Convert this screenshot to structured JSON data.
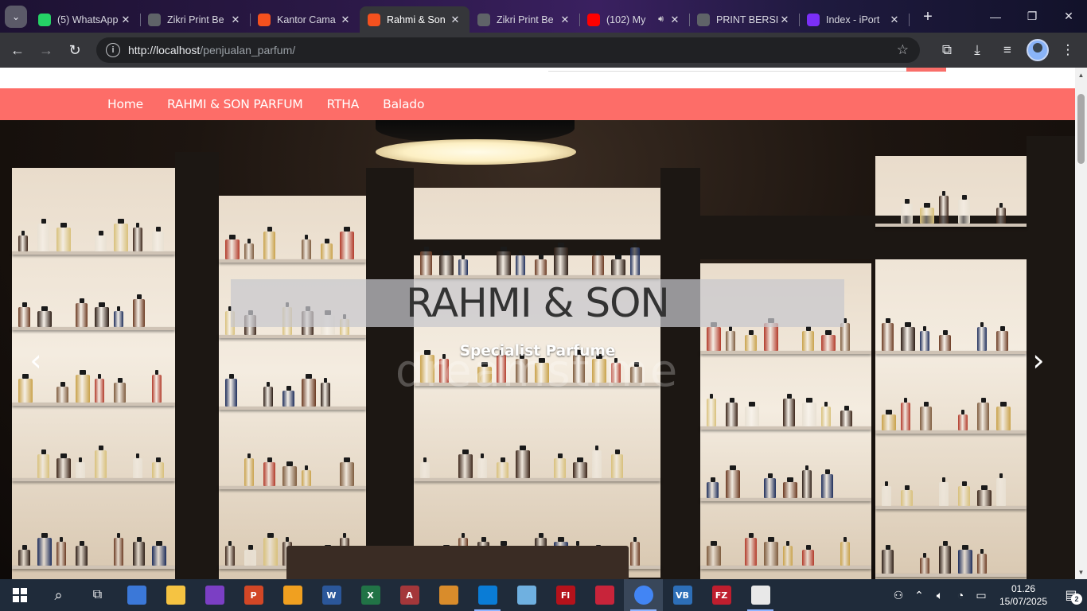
{
  "browser": {
    "tabs": [
      {
        "title": "(5) WhatsApp",
        "favicon_color": "#25d366",
        "favicon_icon": "whatsapp-icon",
        "active": false
      },
      {
        "title": "Zikri Print Be",
        "favicon_color": "#5f6368",
        "favicon_icon": "globe-icon",
        "active": false
      },
      {
        "title": "Kantor Cama",
        "favicon_color": "#f4511e",
        "favicon_icon": "xampp-icon",
        "active": false
      },
      {
        "title": "Rahmi & Son",
        "favicon_color": "#f4511e",
        "favicon_icon": "xampp-icon",
        "active": true
      },
      {
        "title": "Zikri Print Be",
        "favicon_color": "#5f6368",
        "favicon_icon": "globe-icon",
        "active": false
      },
      {
        "title": "(102) My",
        "favicon_color": "#ff0000",
        "favicon_icon": "youtube-icon",
        "active": false,
        "audio": true
      },
      {
        "title": "PRINT BERSI",
        "favicon_color": "#5f6368",
        "favicon_icon": "globe-icon",
        "active": false
      },
      {
        "title": "Index - iPort",
        "favicon_color": "#7b2ff7",
        "favicon_icon": "bootstrap-icon",
        "active": false
      }
    ],
    "url_host": "http://localhost",
    "url_path": "/penjualan_parfum/"
  },
  "site": {
    "accent_color": "#fd6d68",
    "nav": [
      {
        "label": "Home"
      },
      {
        "label": "RAHMI & SON PARFUM"
      },
      {
        "label": "RTHA"
      },
      {
        "label": "Balado"
      }
    ],
    "carousel": {
      "title": "RAHMI & SON",
      "subtitle": "Specialist Parfume",
      "watermark": "dreamstime"
    }
  },
  "taskbar": {
    "apps": [
      {
        "name": "start-button",
        "label": ""
      },
      {
        "name": "search-icon",
        "label": ""
      },
      {
        "name": "task-view-icon",
        "label": ""
      },
      {
        "name": "media-player-icon",
        "label": ""
      },
      {
        "name": "file-explorer-icon",
        "label": ""
      },
      {
        "name": "visual-studio-icon",
        "label": ""
      },
      {
        "name": "powerpoint-icon",
        "label": "P"
      },
      {
        "name": "app-icon",
        "label": ""
      },
      {
        "name": "word-icon",
        "label": "W"
      },
      {
        "name": "excel-icon",
        "label": "X"
      },
      {
        "name": "access-icon",
        "label": "A"
      },
      {
        "name": "app-icon-2",
        "label": ""
      },
      {
        "name": "vscode-icon",
        "label": ""
      },
      {
        "name": "app-icon-3",
        "label": ""
      },
      {
        "name": "flash-icon",
        "label": "Fl"
      },
      {
        "name": "app-icon-4",
        "label": ""
      },
      {
        "name": "chrome-icon",
        "label": ""
      },
      {
        "name": "vb-icon",
        "label": "VB"
      },
      {
        "name": "filezilla-icon",
        "label": "FZ"
      },
      {
        "name": "app-icon-5",
        "label": ""
      }
    ],
    "time": "01.26",
    "date": "15/07/2025",
    "notification_count": "2"
  }
}
